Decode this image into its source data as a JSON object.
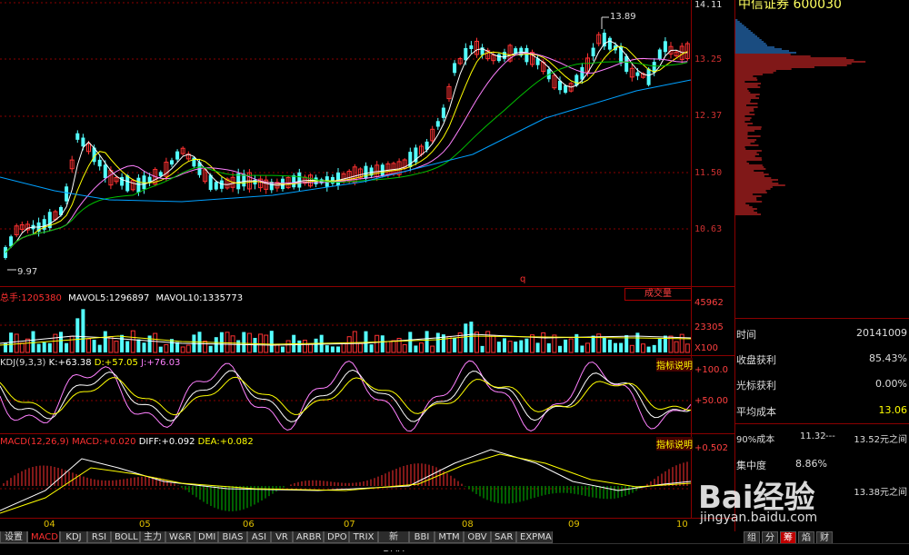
{
  "price_axis": {
    "ticks": [
      "14.11",
      "13.25",
      "12.37",
      "11.50",
      "10.63"
    ]
  },
  "price_annotations": {
    "high": "13.89",
    "low": "9.97",
    "marker": "q"
  },
  "volume_panel": {
    "header_label": "总手:",
    "total": "1205380",
    "mavol5_label": "MAVOL5:",
    "mavol5": "1296897",
    "mavol10_label": "MAVOL10:",
    "mavol10": "1335773",
    "button": "成交量",
    "ticks": [
      "45962",
      "23305",
      "X100"
    ]
  },
  "kdj_panel": {
    "header": "KDJ(9,3,3)",
    "k_label": "K:",
    "k": "+63.38",
    "d_label": "D:",
    "d": "+57.05",
    "j_label": "J:",
    "j": "+76.03",
    "button": "指标说明",
    "ticks": [
      "+100.0",
      "+50.00"
    ]
  },
  "macd_panel": {
    "header": "MACD(12,26,9)",
    "macd_label": "MACD:",
    "macd": "+0.020",
    "diff_label": "DIFF:",
    "diff": "+0.092",
    "dea_label": "DEA:",
    "dea": "+0.082",
    "button": "指标说明",
    "ticks": [
      "+0.502"
    ]
  },
  "months": [
    "04",
    "05",
    "06",
    "07",
    "08",
    "09",
    "10"
  ],
  "tabs": [
    "设置",
    "MACD",
    "KDJ",
    "RSI",
    "BOLL",
    "主力",
    "W&R",
    "DMI",
    "BIAS",
    "ASI",
    "VR",
    "ARBR",
    "DPO",
    "TRIX",
    "新DMA",
    "BBI",
    "MTM",
    "OBV",
    "SAR",
    "EXPMA"
  ],
  "active_tab": "MACD",
  "sidebar": {
    "title": "中信证券 600030",
    "rows": [
      {
        "label": "时间",
        "value": "20141009"
      },
      {
        "label": "收盘获利",
        "value": "85.43%"
      },
      {
        "label": "光标获利",
        "value": "0.00%"
      },
      {
        "label": "平均成本",
        "value": "13.06"
      }
    ],
    "cost90_label": "90%成本",
    "cost90_low": "11.32",
    "cost90_sep": "---",
    "cost90_high": "13.52元之间",
    "concentration_label": "集中度",
    "concentration_value": "8.86%",
    "cost70_high": "13.38元之间",
    "bottom_tabs": [
      "组",
      "分",
      "筹",
      "焰",
      "财"
    ]
  },
  "watermark": {
    "brand": "Bai经验",
    "url": "jingyan.baidu.com"
  },
  "colors": {
    "up": "#ff3232",
    "down": "#54ffff",
    "ma5": "#ffffff",
    "ma10": "#ffff00",
    "ma20": "#ff80ff",
    "ma30": "#00c000",
    "ma60": "#00a0ff",
    "grid": "#8b0000"
  }
}
